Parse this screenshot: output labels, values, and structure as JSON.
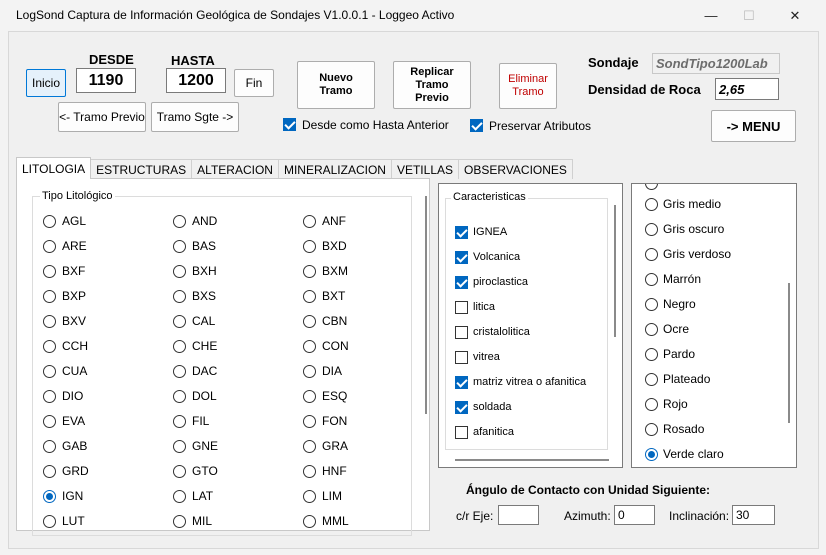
{
  "window": {
    "title": "LogSond Captura de Información Geológica de Sondajes V1.0.0.1 - Loggeo Activo",
    "minimize": "—",
    "maximize": "☐",
    "close": "✕"
  },
  "nav": {
    "desde_label": "DESDE",
    "hasta_label": "HASTA",
    "desde_value": "1190",
    "hasta_value": "1200",
    "inicio": "Inicio",
    "fin": "Fin",
    "tramo_previo": "<- Tramo Previo",
    "tramo_sgte": "Tramo Sgte ->"
  },
  "actions": {
    "nuevo_tramo": "Nuevo\nTramo",
    "replicar_tramo": "Replicar\nTramo\nPrevio",
    "eliminar_tramo": "Eliminar\nTramo",
    "desde_como_hasta": "Desde como Hasta Anterior",
    "preservar_atributos": "Preservar Atributos"
  },
  "info": {
    "sondaje_label": "Sondaje",
    "sondaje_value": "SondTipo1200Lab",
    "densidad_label": "Densidad de Roca",
    "densidad_value": "2,65",
    "menu": "-> MENU"
  },
  "tabs": [
    "LITOLOGIA",
    "ESTRUCTURAS",
    "ALTERACION",
    "MINERALIZACION",
    "VETILLAS",
    "OBSERVACIONES"
  ],
  "tipo_litologico": {
    "label": "Tipo Litológico",
    "col1": [
      "AGL",
      "ARE",
      "BXF",
      "BXP",
      "BXV",
      "CCH",
      "CUA",
      "DIO",
      "EVA",
      "GAB",
      "GRD",
      "IGN",
      "LUT"
    ],
    "col2": [
      "AND",
      "BAS",
      "BXH",
      "BXS",
      "CAL",
      "CHE",
      "DAC",
      "DOL",
      "FIL",
      "GNE",
      "GTO",
      "LAT",
      "MIL"
    ],
    "col3": [
      "ANF",
      "BXD",
      "BXM",
      "BXT",
      "CBN",
      "CON",
      "DIA",
      "ESQ",
      "FON",
      "GRA",
      "HNF",
      "LIM",
      "MML"
    ],
    "selected": "IGN"
  },
  "caracteristicas": {
    "label": "Caracteristicas",
    "items": [
      {
        "label": "IGNEA",
        "checked": true
      },
      {
        "label": "Volcanica",
        "checked": true
      },
      {
        "label": "piroclastica",
        "checked": true
      },
      {
        "label": "litica",
        "checked": false
      },
      {
        "label": "cristalolitica",
        "checked": false
      },
      {
        "label": "vitrea",
        "checked": false
      },
      {
        "label": "matriz vitrea o afanitica",
        "checked": true
      },
      {
        "label": "soldada",
        "checked": true
      },
      {
        "label": "afanitica",
        "checked": false
      }
    ]
  },
  "colores": {
    "items": [
      "Gris medio",
      "Gris oscuro",
      "Gris verdoso",
      "Marrón",
      "Negro",
      "Ocre",
      "Pardo",
      "Plateado",
      "Rojo",
      "Rosado",
      "Verde claro"
    ],
    "selected": "Verde claro"
  },
  "contacto": {
    "title": "Ángulo de Contacto con Unidad Siguiente:",
    "cr_eje_label": "c/r Eje:",
    "cr_eje_value": "",
    "azimuth_label": "Azimuth:",
    "azimuth_value": "0",
    "inclinacion_label": "Inclinación:",
    "inclinacion_value": "30"
  },
  "colors": {
    "accent": "#0067c0",
    "eliminar_text": "#c00000"
  }
}
